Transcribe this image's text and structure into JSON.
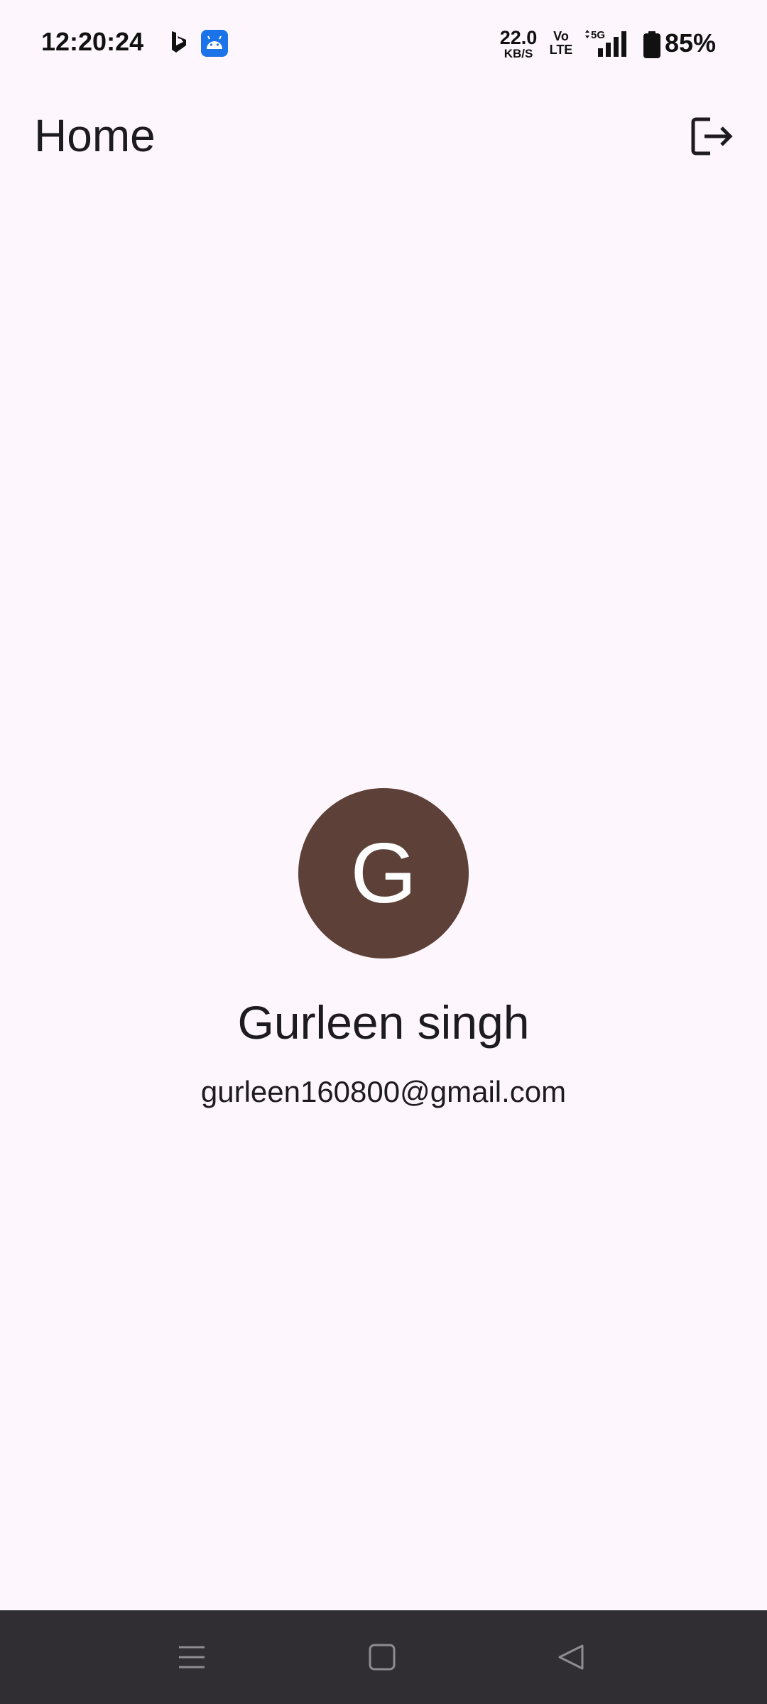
{
  "status_bar": {
    "time": "12:20:24",
    "net_speed_value": "22.0",
    "net_speed_unit": "KB/S",
    "volte_top": "Vo",
    "volte_bottom": "LTE",
    "network_type": "5G",
    "battery_percent": "85%",
    "icons": [
      "bing-icon",
      "android-icon",
      "signal-icon",
      "battery-icon"
    ]
  },
  "app_bar": {
    "title": "Home",
    "action_icon": "logout-icon"
  },
  "profile": {
    "avatar_letter": "G",
    "avatar_color": "#5d4037",
    "name": "Gurleen singh",
    "email": "gurleen160800@gmail.com"
  },
  "nav_bar": {
    "buttons": [
      "menu-icon",
      "home-icon",
      "back-icon"
    ]
  },
  "colors": {
    "background": "#fdf7fd",
    "nav_background": "#302e33",
    "text": "#1d1b20"
  }
}
